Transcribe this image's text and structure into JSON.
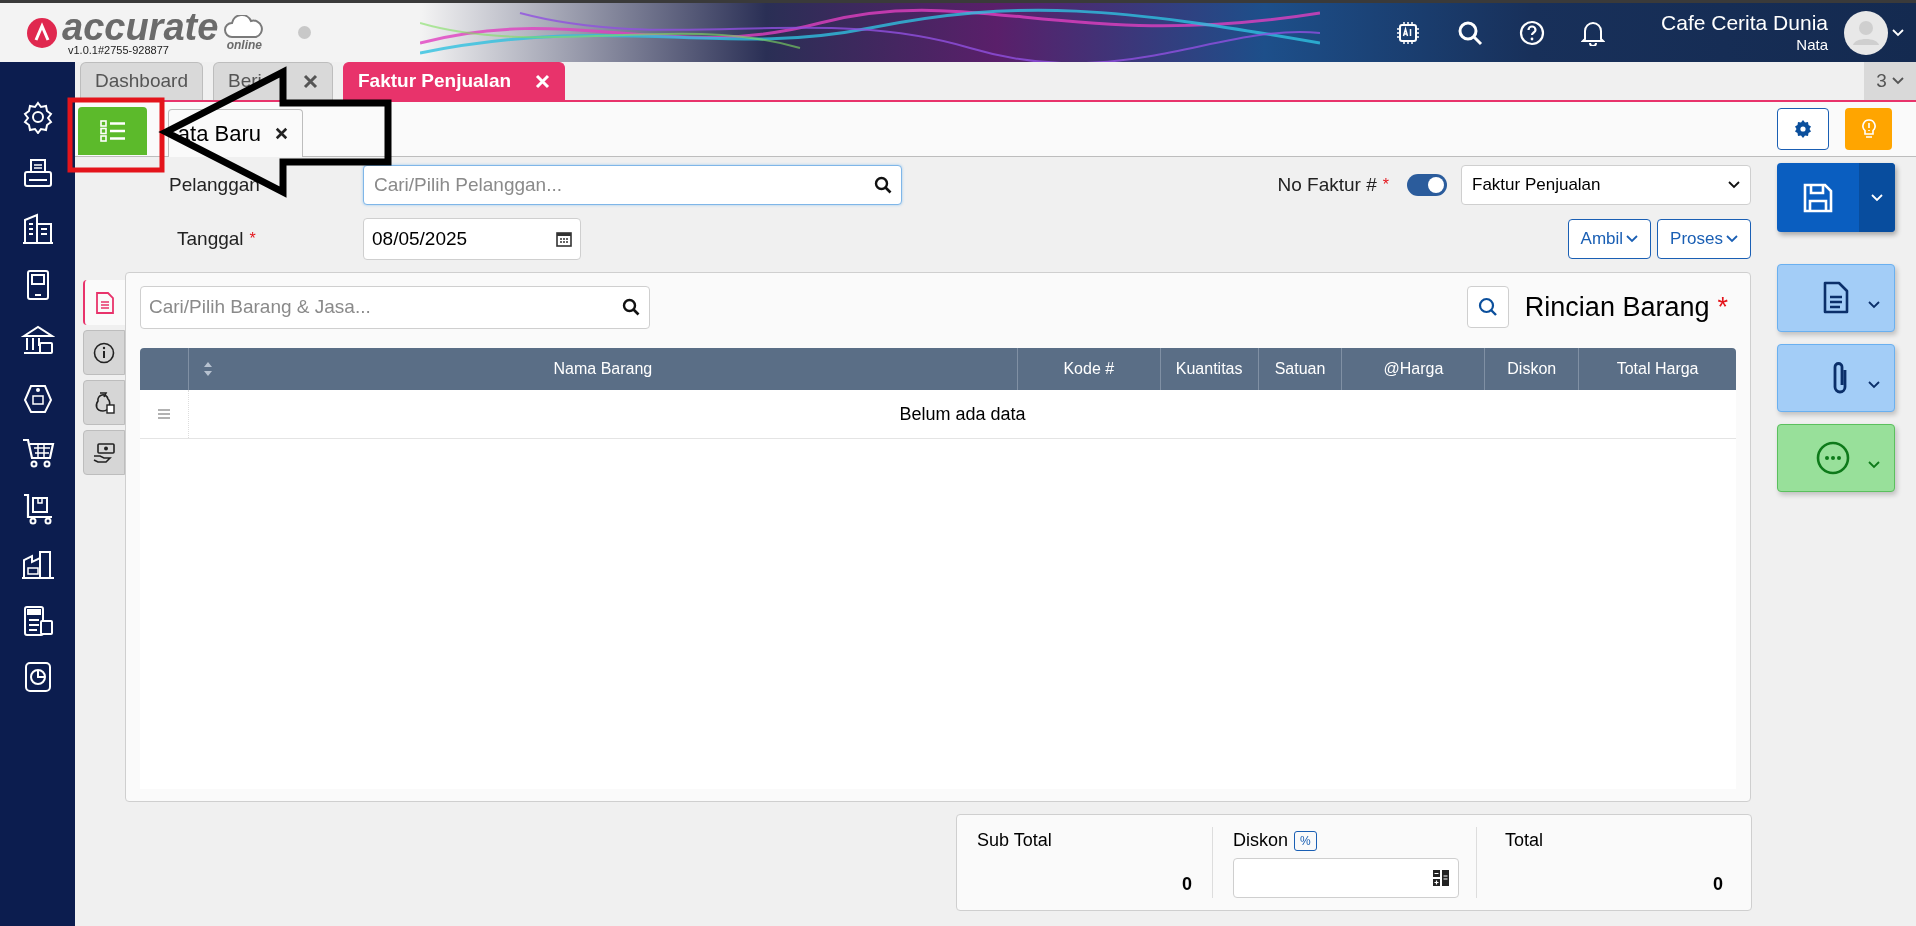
{
  "header": {
    "logo": "accurate",
    "logo_sub": "online",
    "version": "v1.0.1#2755-928877",
    "company": "Cafe Cerita Dunia",
    "user": "Nata"
  },
  "tabs": [
    {
      "label": "Dashboard",
      "selected": false,
      "closable": false
    },
    {
      "label": "Beri",
      "selected": false,
      "closable": true
    },
    {
      "label": "Faktur Penjualan",
      "selected": true,
      "closable": true
    }
  ],
  "tab_count": "3",
  "subtabs": [
    {
      "label": "ata Baru",
      "selected": true,
      "closable": true
    }
  ],
  "form": {
    "customer": {
      "label": "Pelanggan",
      "placeholder": "Cari/Pilih Pelanggan..."
    },
    "date": {
      "label": "Tanggal",
      "required_mark": "*",
      "value": "08/05/2025"
    },
    "invoice_no": {
      "label": "No Faktur #",
      "required_mark": "*",
      "auto_number": true,
      "type_value": "Faktur Penjualan"
    },
    "buttons": [
      "Ambil",
      "Proses"
    ]
  },
  "side_tabs": [
    {
      "kind": "document",
      "selected": true
    },
    {
      "kind": "info",
      "selected": false
    },
    {
      "kind": "money-bag",
      "selected": false
    },
    {
      "kind": "payment",
      "selected": false
    }
  ],
  "items": {
    "search": {
      "placeholder": "Cari/Pilih Barang & Jasa..."
    },
    "title": "Rincian Barang",
    "required_mark": "*",
    "columns": [
      "Nama Barang",
      "Kode #",
      "Kuantitas",
      "Satuan",
      "@Harga",
      "Diskon",
      "Total Harga"
    ],
    "empty_message": "Belum ada data"
  },
  "totals": {
    "sub_total": {
      "label": "Sub Total",
      "value": "0"
    },
    "discount": {
      "label": "Diskon",
      "badge": "%"
    },
    "total": {
      "label": "Total",
      "value": "0"
    }
  }
}
